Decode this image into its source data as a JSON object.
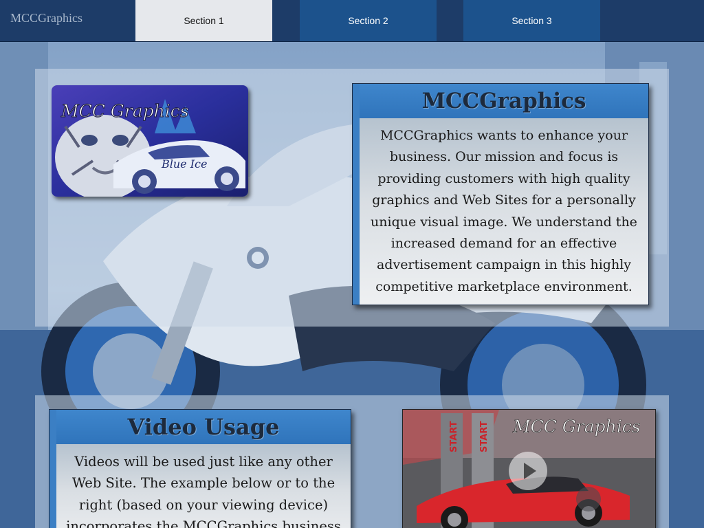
{
  "nav": {
    "brand": "MCCGraphics",
    "tabs": [
      {
        "label": "Section 1",
        "active": true
      },
      {
        "label": "Section 2",
        "active": false
      },
      {
        "label": "Section 3",
        "active": false
      }
    ]
  },
  "logo_card": {
    "title": "MCC Graphics",
    "subtitle": "Blue Ice"
  },
  "intro": {
    "title": "MCCGraphics",
    "text": "MCCGraphics wants to enhance your business. Our mission and focus is providing customers with high quality graphics and Web Sites for a personally unique visual image. We understand the increased demand for an effective advertisement campaign in this highly competitive marketplace environment."
  },
  "video": {
    "title": "Video Usage",
    "text": "Videos will be used just like any other Web Site. The example below or to the right (based on your viewing device) incorporates the MCCGraphics business",
    "thumb_title": "MCC Graphics",
    "thumb_signs": [
      "START",
      "START"
    ]
  },
  "colors": {
    "nav_bg": "#1d3c68",
    "tab_bg": "#1c528c",
    "tab_active_bg": "#e6e8ec",
    "box_head": "#3b7fc4"
  }
}
